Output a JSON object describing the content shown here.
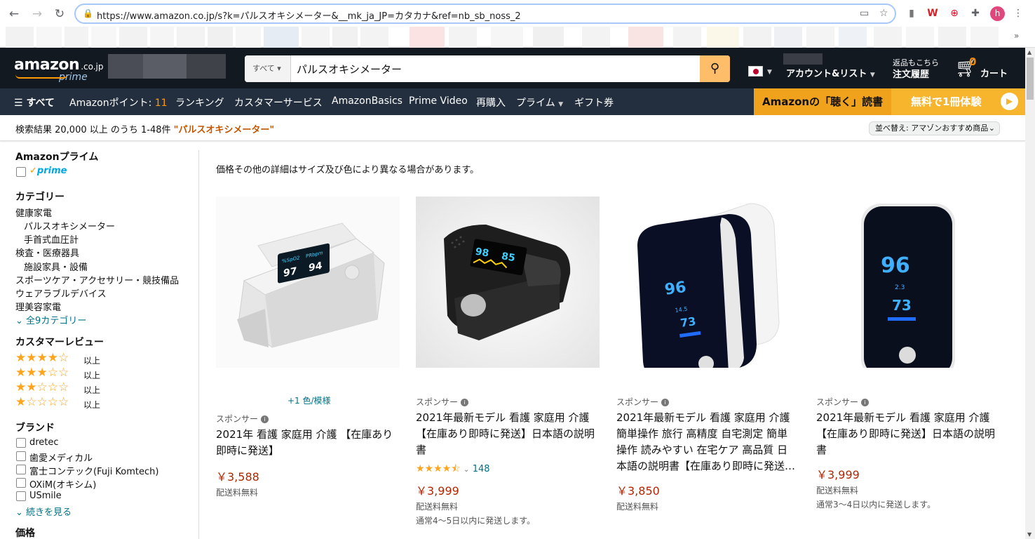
{
  "browser": {
    "url": "https://www.amazon.co.jp/s?k=パルスオキシメーター&__mk_ja_JP=カタカナ&ref=nb_sb_noss_2",
    "profile_initial": "h",
    "bookmarks_more": "»"
  },
  "header": {
    "logo_word": "amazon",
    "logo_tld": ".co.jp",
    "logo_prime": "prime",
    "search_category": "すべて",
    "search_query": "パルスオキシメーター",
    "account_label": "アカウント&リスト",
    "orders_top": "返品もこちら",
    "orders_bottom": "注文履歴",
    "cart_count": "0",
    "cart_label": "カート"
  },
  "subnav": {
    "all": "すべて",
    "points_label": "Amazonポイント: ",
    "points_value": "11",
    "items": [
      "ランキング",
      "カスタマーサービス",
      "AmazonBasics",
      "Prime Video",
      "再購入",
      "プライム",
      "ギフト券"
    ],
    "banner_left": "Amazonの「聴く」読書",
    "banner_right": "無料で1冊体験"
  },
  "results_bar": {
    "prefix": "検索結果 20,000 以上 のうち 1-48件 ",
    "query": "\"パルスオキシメーター\"",
    "sort_label": "並べ替え: アマゾンおすすめ商品"
  },
  "sidebar": {
    "prime_title": "Amazonプライム",
    "prime_badge": "prime",
    "category_title": "カテゴリー",
    "categories": [
      "健康家電",
      "パルスオキシメーター",
      "手首式血圧計",
      "検査・医療器具",
      "施設家具・設備",
      "スポーツケア・アクセサリー・競技備品",
      "ウェアラブルデバイス",
      "理美容家電"
    ],
    "categories_more": "全9カテゴリー",
    "review_title": "カスタマーレビュー",
    "review_suffix": "以上",
    "review_levels": [
      4,
      3,
      2,
      1
    ],
    "brand_title": "ブランド",
    "brands": [
      "dretec",
      "歯愛メディカル",
      "富士コンテック(Fuji Komtech)",
      "OXiM(オキシム)",
      "USmile"
    ],
    "brands_more": "続きを見る",
    "price_title": "価格"
  },
  "main": {
    "note": "価格その他の詳細はサイズ及び色により異なる場合があります。",
    "products": [
      {
        "colors": "+1 色/模様",
        "sponsored": "スポンサー",
        "title_lines": [
          "2021年 看護 家庭用 介護 【在庫あり",
          "即時に発送】"
        ],
        "price": "￥3,588",
        "shipping": "配送料無料",
        "delivery": ""
      },
      {
        "colors": "",
        "sponsored": "スポンサー",
        "title_lines": [
          "2021年最新モデル 看護 家庭用 介護",
          "【在庫あり即時に発送】日本語の説明",
          "書"
        ],
        "rating": 4.5,
        "rating_count": "148",
        "price": "￥3,999",
        "shipping": "配送料無料",
        "delivery": "通常4～5日以内に発送します。"
      },
      {
        "colors": "",
        "sponsored": "スポンサー",
        "title_lines": [
          "2021年最新モデル 看護 家庭用 介護",
          "簡単操作 旅行 高精度 自宅測定 簡単",
          "操作 読みやすい 在宅ケア 高品質 日",
          "本語の説明書【在庫あり即時に発送…"
        ],
        "price": "￥3,850",
        "shipping": "配送料無料",
        "delivery": ""
      },
      {
        "colors": "",
        "sponsored": "スポンサー",
        "title_lines": [
          "2021年最新モデル 看護 家庭用 介護",
          "【在庫あり即時に発送】日本語の説明",
          "書"
        ],
        "price": "￥3,999",
        "shipping": "配送料無料",
        "delivery": "通常3～4日以内に発送します。"
      }
    ],
    "device_readings": [
      {
        "spo2": "97",
        "pr": "94",
        "spo2_label": "%SpO2",
        "pr_label": "PRbpm"
      },
      {
        "spo2": "98",
        "pr": "85"
      },
      {
        "spo2": "96",
        "pr": "73",
        "pi": "14.5"
      },
      {
        "spo2": "96",
        "pr": "73",
        "pi": "2.3"
      }
    ]
  },
  "colors": {
    "nav_dark": "#131921",
    "nav_sub": "#232f3e",
    "accent_orange": "#febd69",
    "price_red": "#b12704",
    "link_teal": "#007185",
    "star": "#ffa41c"
  }
}
